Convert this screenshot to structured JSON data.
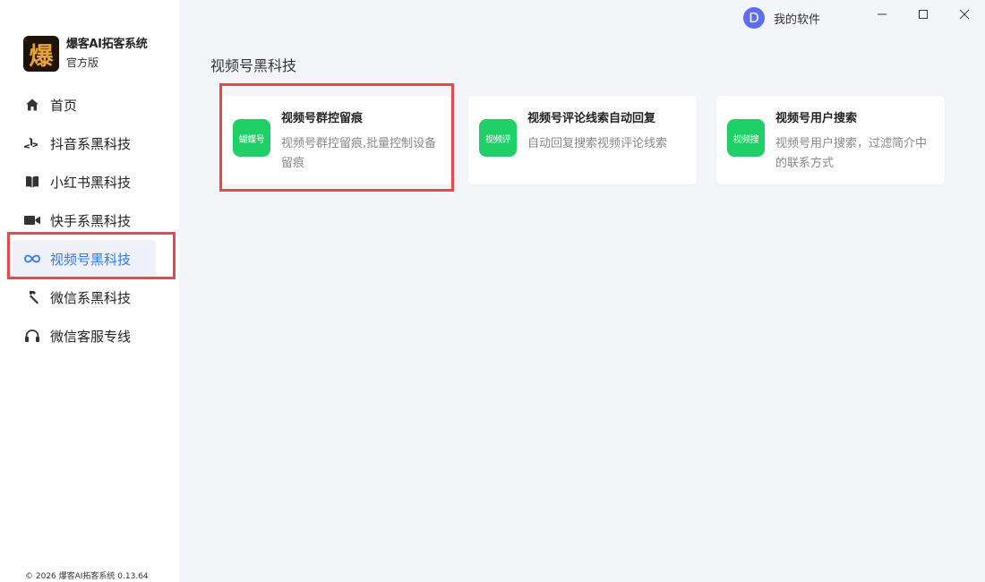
{
  "brand": {
    "logo_char": "爆",
    "name": "爆客AI拓客系统",
    "edition": "官方版"
  },
  "nav": {
    "items": [
      {
        "label": "首页",
        "icon": "home-icon"
      },
      {
        "label": "抖音系黑科技",
        "icon": "gamepad-icon"
      },
      {
        "label": "小红书黑科技",
        "icon": "book-icon"
      },
      {
        "label": "快手系黑科技",
        "icon": "video-camera-icon"
      },
      {
        "label": "视频号黑科技",
        "icon": "infinity-icon",
        "active": true
      },
      {
        "label": "微信系黑科技",
        "icon": "hammer-icon"
      },
      {
        "label": "微信客服专线",
        "icon": "headset-icon"
      }
    ]
  },
  "footer": "© 2026 爆客AI拓客系统 0.13.64",
  "topbar": {
    "avatar_letter": "D",
    "user_label": "我的软件"
  },
  "main": {
    "section_title": "视频号黑科技",
    "cards": [
      {
        "icon_text": "蝴蝶号",
        "title": "视频号群控留痕",
        "desc": "视频号群控留痕,批量控制设备留痕"
      },
      {
        "icon_text": "视频评",
        "title": "视频号评论线索自动回复",
        "desc": "自动回复搜索视频评论线索"
      },
      {
        "icon_text": "视频搜",
        "title": "视频号用户搜索",
        "desc": "视频号用户搜索，过滤简介中的联系方式"
      }
    ]
  },
  "colors": {
    "accent": "#2f7bf5",
    "card_icon_bg": "#1fd066",
    "highlight": "#e5484d",
    "avatar_bg": "#5b6ef5"
  }
}
